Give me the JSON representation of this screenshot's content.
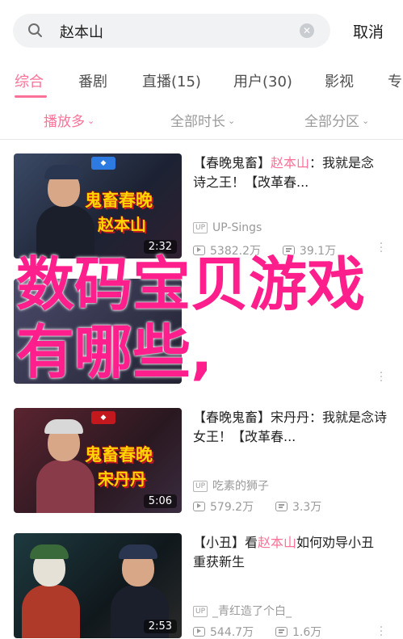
{
  "search": {
    "query": "赵本山",
    "cancel_label": "取消"
  },
  "tabs": [
    {
      "label": "综合",
      "active": true
    },
    {
      "label": "番剧",
      "active": false
    },
    {
      "label": "直播(15)",
      "active": false
    },
    {
      "label": "用户(30)",
      "active": false
    },
    {
      "label": "影视",
      "active": false
    },
    {
      "label": "专",
      "active": false
    }
  ],
  "filters": [
    {
      "label": "播放多",
      "active": true
    },
    {
      "label": "全部时长",
      "active": false
    },
    {
      "label": "全部分区",
      "active": false
    }
  ],
  "overlay": {
    "text": "数码宝贝游戏有哪些,"
  },
  "videos": [
    {
      "title_pre": "【春晚鬼畜】",
      "title_hl": "赵本山",
      "title_post": "：我就是念诗之王！【改革春...",
      "thumb_line1": "鬼畜春晚",
      "thumb_line2": "赵本山",
      "duration": "2:32",
      "uploader": "UP-Sings",
      "views": "5382.2万",
      "danmaku": "39.1万"
    },
    {
      "title_pre": "",
      "title_hl": "",
      "title_post": "",
      "thumb_line1": "",
      "thumb_line2": "",
      "duration": "",
      "uploader": "",
      "views": "",
      "danmaku": ""
    },
    {
      "title_pre": "【春晚鬼畜】宋丹丹：我就是念诗女王！【改革春...",
      "title_hl": "",
      "title_post": "",
      "thumb_line1": "鬼畜春晚",
      "thumb_line2": "宋丹丹",
      "duration": "5:06",
      "uploader": "吃素的狮子",
      "views": "579.2万",
      "danmaku": "3.3万"
    },
    {
      "title_pre": "【小丑】看",
      "title_hl": "赵本山",
      "title_post": "如何劝导小丑重获新生",
      "thumb_line1": "",
      "thumb_line2": "",
      "duration": "2:53",
      "uploader": "_青红造了个白_",
      "views": "544.7万",
      "danmaku": "1.6万"
    }
  ],
  "colors": {
    "accent": "#fb7299",
    "overlay": "#ff1f8c"
  }
}
